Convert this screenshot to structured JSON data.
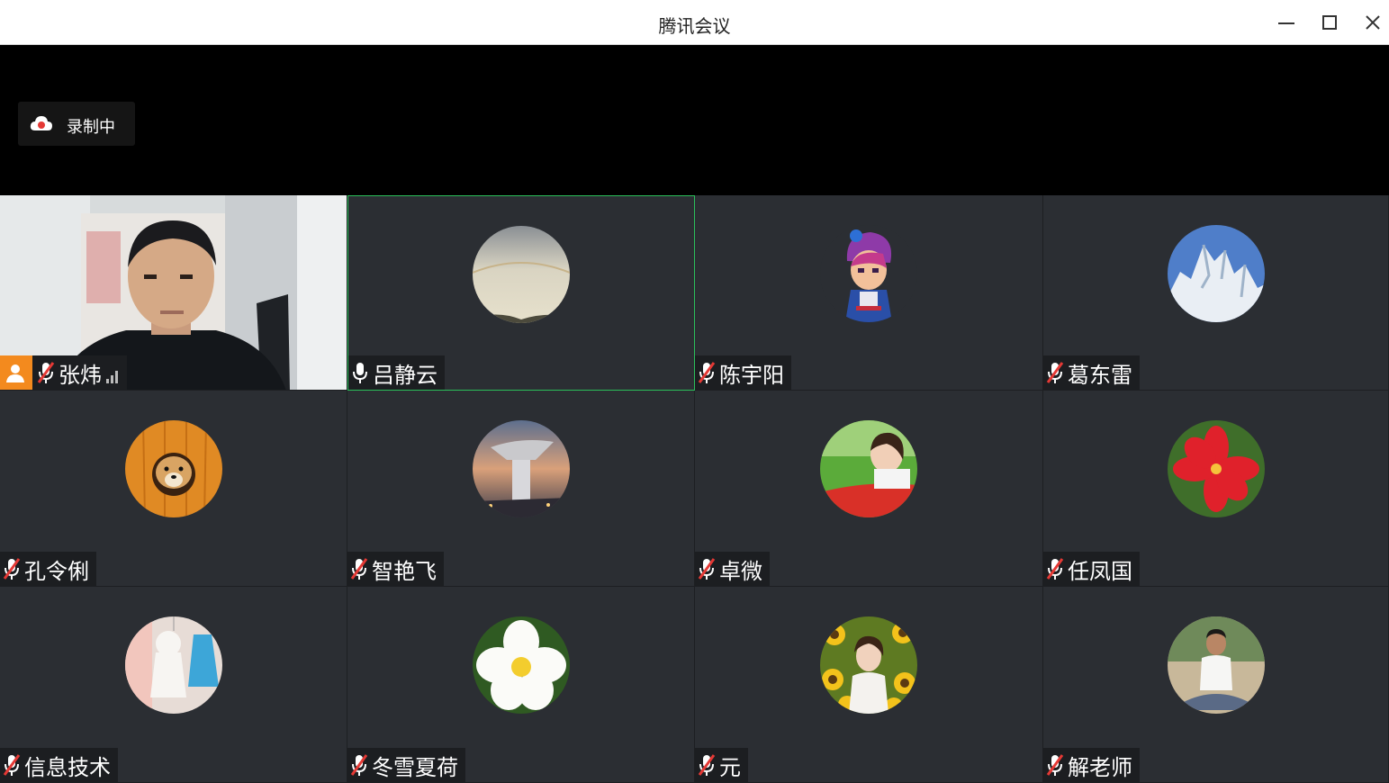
{
  "window": {
    "title": "腾讯会议"
  },
  "recording": {
    "label": "录制中",
    "icon": "cloud-icon"
  },
  "participants": [
    {
      "name": "张炜",
      "mic": "muted",
      "host": true,
      "video": true
    },
    {
      "name": "吕静云",
      "mic": "on",
      "active_speaker": true,
      "avatar": "sunset-sky"
    },
    {
      "name": "陈宇阳",
      "mic": "muted",
      "avatar": "cartoon-character"
    },
    {
      "name": "葛东雷",
      "mic": "muted",
      "avatar": "snowy-mountain"
    },
    {
      "name": "孔令俐",
      "mic": "muted",
      "avatar": "dog-in-wood"
    },
    {
      "name": "智艳飞",
      "mic": "muted",
      "avatar": "city-tower"
    },
    {
      "name": "卓微",
      "mic": "muted",
      "avatar": "girl-in-field"
    },
    {
      "name": "任凤国",
      "mic": "muted",
      "avatar": "red-flower"
    },
    {
      "name": "信息技术",
      "mic": "muted",
      "avatar": "hanging-dolls"
    },
    {
      "name": "冬雪夏荷",
      "mic": "muted",
      "avatar": "white-flower"
    },
    {
      "name": "元",
      "mic": "muted",
      "avatar": "sunflowers"
    },
    {
      "name": "解老师",
      "mic": "muted",
      "avatar": "man-sitting"
    }
  ],
  "colors": {
    "tile_bg": "#2b2e33",
    "active_border": "#2bbf5a",
    "host_badge": "#f38a1e",
    "muted_mark": "#e53935"
  }
}
